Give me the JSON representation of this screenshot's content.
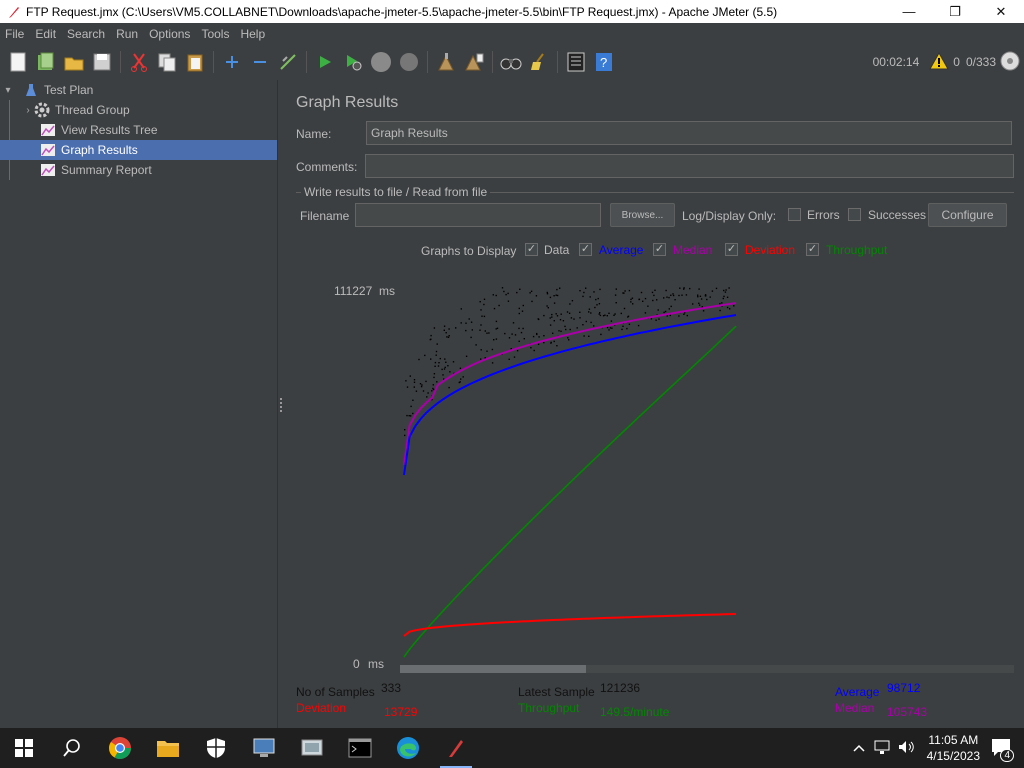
{
  "window": {
    "title": "FTP Request.jmx (C:\\Users\\VM5.COLLABNET\\Downloads\\apache-jmeter-5.5\\apache-jmeter-5.5\\bin\\FTP Request.jmx) - Apache JMeter (5.5)",
    "minimize": "—",
    "maximize": "❐",
    "close": "✕"
  },
  "menu": [
    "File",
    "Edit",
    "Search",
    "Run",
    "Options",
    "Tools",
    "Help"
  ],
  "toolbar": {
    "timer": "00:02:14",
    "warnings": "0",
    "threads": "0/333"
  },
  "tree": {
    "items": [
      {
        "label": "Test Plan",
        "icon": "flask-icon"
      },
      {
        "label": "Thread Group",
        "icon": "gear-icon"
      },
      {
        "label": "View Results Tree",
        "icon": "listener-chart-icon"
      },
      {
        "label": "Graph Results",
        "icon": "listener-chart-icon"
      },
      {
        "label": "Summary Report",
        "icon": "listener-chart-icon"
      }
    ]
  },
  "panel": {
    "title": "Graph Results",
    "name_label": "Name:",
    "name_value": "Graph Results",
    "comments_label": "Comments:",
    "comments_value": "",
    "group_title": "Write results to file / Read from file",
    "filename_label": "Filename",
    "filename_value": "",
    "browse": "Browse...",
    "log_only": "Log/Display Only:",
    "errors": "Errors",
    "successes": "Successes",
    "configure": "Configure",
    "graphs_to_display": "Graphs to Display",
    "series": [
      {
        "label": "Data",
        "color": "#bbbbbb",
        "checked": true
      },
      {
        "label": "Average",
        "color": "#0000ff",
        "checked": true
      },
      {
        "label": "Median",
        "color": "#aa00aa",
        "checked": true
      },
      {
        "label": "Deviation",
        "color": "#ff0000",
        "checked": true
      },
      {
        "label": "Throughput",
        "color": "#008800",
        "checked": true
      }
    ]
  },
  "graph": {
    "y_max_label": "111227",
    "y_min_label": "0",
    "unit": "ms"
  },
  "chart_data": {
    "type": "line",
    "ylim": [
      0,
      111227
    ],
    "y_unit": "ms",
    "samples": 333,
    "series": [
      {
        "name": "Average",
        "color": "#0000ff"
      },
      {
        "name": "Median",
        "color": "#aa00aa"
      },
      {
        "name": "Deviation",
        "color": "#ff0000"
      },
      {
        "name": "Throughput",
        "color": "#008800"
      },
      {
        "name": "Data",
        "color": "#000000"
      }
    ]
  },
  "stats": {
    "no_samples_label": "No of Samples",
    "no_samples_value": "333",
    "latest_label": "Latest Sample",
    "latest_value": "121236",
    "average_label": "Average",
    "average_value": "98712",
    "deviation_label": "Deviation",
    "deviation_value": "13729",
    "throughput_label": "Throughput",
    "throughput_value": "149.5/minute",
    "median_label": "Median",
    "median_value": "105743"
  },
  "taskbar": {
    "time": "11:05 AM",
    "date": "4/15/2023",
    "notifications": "4"
  }
}
